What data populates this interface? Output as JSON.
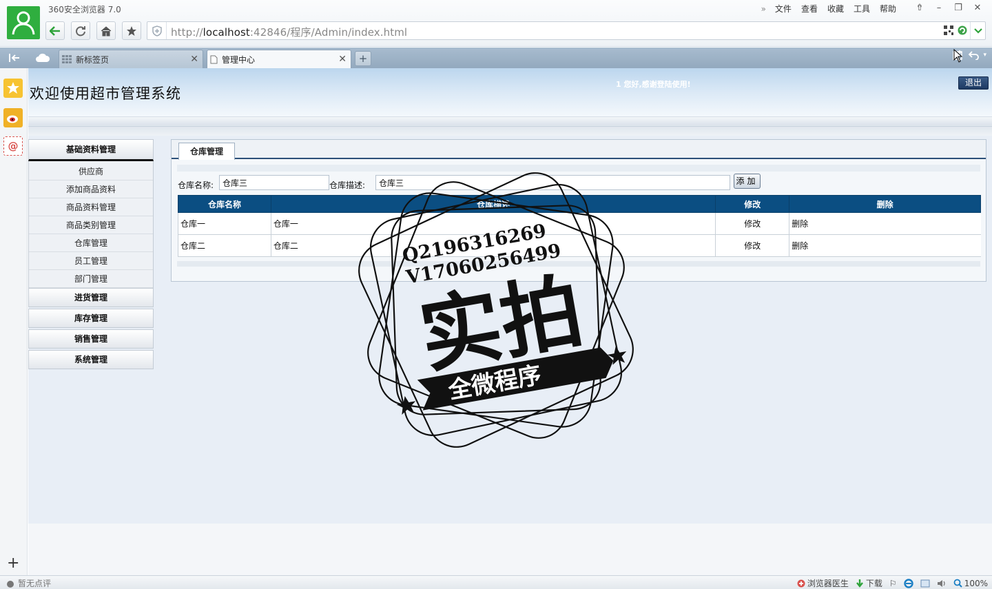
{
  "browser": {
    "title": "360安全浏览器 7.0",
    "menu": [
      "文件",
      "查看",
      "收藏",
      "工具",
      "帮助"
    ],
    "address": {
      "prefix": "http://",
      "host": "localhost",
      "rest": ":42846/程序/Admin/index.html"
    },
    "tabs": [
      {
        "label": "新标签页",
        "active": false
      },
      {
        "label": "管理中心",
        "active": true
      }
    ]
  },
  "header": {
    "site_title": "欢迎使用超市管理系统",
    "welcome": "1 您好,感谢登陆使用!",
    "logout": "退出"
  },
  "sidebar": {
    "sections": [
      {
        "label": "基础资料管理",
        "expanded": true,
        "items": [
          "供应商",
          "添加商品资料",
          "商品资料管理",
          "商品类别管理",
          "仓库管理",
          "员工管理",
          "部门管理"
        ]
      },
      {
        "label": "进货管理"
      },
      {
        "label": "库存管理"
      },
      {
        "label": "销售管理"
      },
      {
        "label": "系统管理"
      }
    ]
  },
  "panel": {
    "tab_label": "仓库管理",
    "form": {
      "name_label": "仓库名称:",
      "name_value": "仓库三",
      "desc_label": "仓库描述:",
      "desc_value": "仓库三",
      "add_button": "添加"
    },
    "table": {
      "headers": [
        "仓库名称",
        "仓库描述",
        "修改",
        "删除"
      ],
      "rows": [
        {
          "name": "仓库一",
          "desc": "仓库一",
          "edit": "修改",
          "delete": "删除"
        },
        {
          "name": "仓库二",
          "desc": "仓库二",
          "edit": "修改",
          "delete": "删除"
        }
      ]
    }
  },
  "watermark": {
    "line1": "Q2196316269",
    "line2": "V17060256499",
    "main": "实拍",
    "banner": "全微程序"
  },
  "statusbar": {
    "left": "暂无点评",
    "doctor": "浏览器医生",
    "download": "下载",
    "zoom": "100%"
  },
  "colors": {
    "table_header": "#0b4e82",
    "accent_green": "#2fae3f",
    "logout_bg": "#1d3a62"
  }
}
